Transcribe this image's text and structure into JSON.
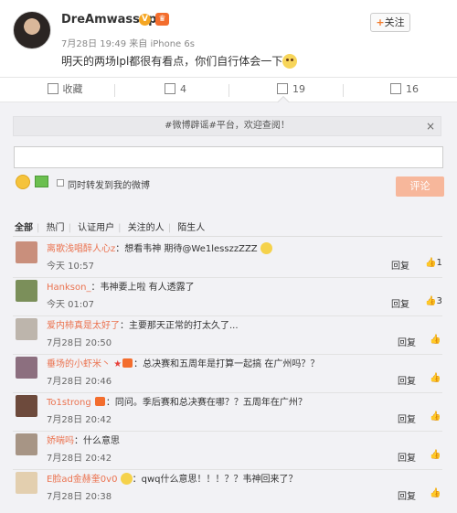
{
  "post": {
    "username": "DreAmwassup",
    "time": "7月28日 19:49",
    "source": "来自 iPhone 6s",
    "text": "明天的两场lpl都很有看点，你们自行体会一下",
    "follow_label": "关注"
  },
  "actions": {
    "favorite": "收藏",
    "repost_count": "4",
    "comment_count": "19",
    "like_count": "16"
  },
  "comment_area": {
    "notice": "#微博辟谣#平台，欢迎查阅！",
    "repost_label": "同时转发到我的微博",
    "submit_label": "评论",
    "filters": [
      "全部",
      "热门",
      "认证用户",
      "关注的人",
      "陌生人"
    ]
  },
  "comments": [
    {
      "name": "离歌浅唱醉人心z",
      "text": "：想看韦神 期待@We1lesszzZZZ",
      "time": "今天 10:57",
      "reply": "回复",
      "likes": "1"
    },
    {
      "name": "Hankson_",
      "text": "：韦神要上啦 有人透露了",
      "time": "今天 01:07",
      "reply": "回复",
      "likes": "3"
    },
    {
      "name": "爱内柿真是太好了",
      "text": "：主要那天正常的打太久了...",
      "time": "7月28日 20:50",
      "reply": "回复",
      "likes": "1"
    },
    {
      "name": "垂场的小虾米丶",
      "text": "：总决赛和五周年是打算一起搞 在广州吗？？",
      "time": "7月28日 20:46",
      "reply": "回复",
      "likes": "1"
    },
    {
      "name": "To1strong",
      "text": "：同问。季后赛和总决赛在哪？？五周年在广州？",
      "time": "7月28日 20:42",
      "reply": "回复",
      "likes": "1"
    },
    {
      "name": "娇喘吗",
      "text": "：什么意思",
      "time": "7月28日 20:42",
      "reply": "回复",
      "likes": "1"
    },
    {
      "name": "E脸ad金赫奎0v0",
      "text": "：qwq什么意思！！！？？韦神回来了？",
      "time": "7月28日 20:38",
      "reply": "回复",
      "likes": "1"
    }
  ],
  "colors": {
    "accent": "#eb7350",
    "submit": "#f7b79b",
    "background": "#f2f2f5"
  }
}
